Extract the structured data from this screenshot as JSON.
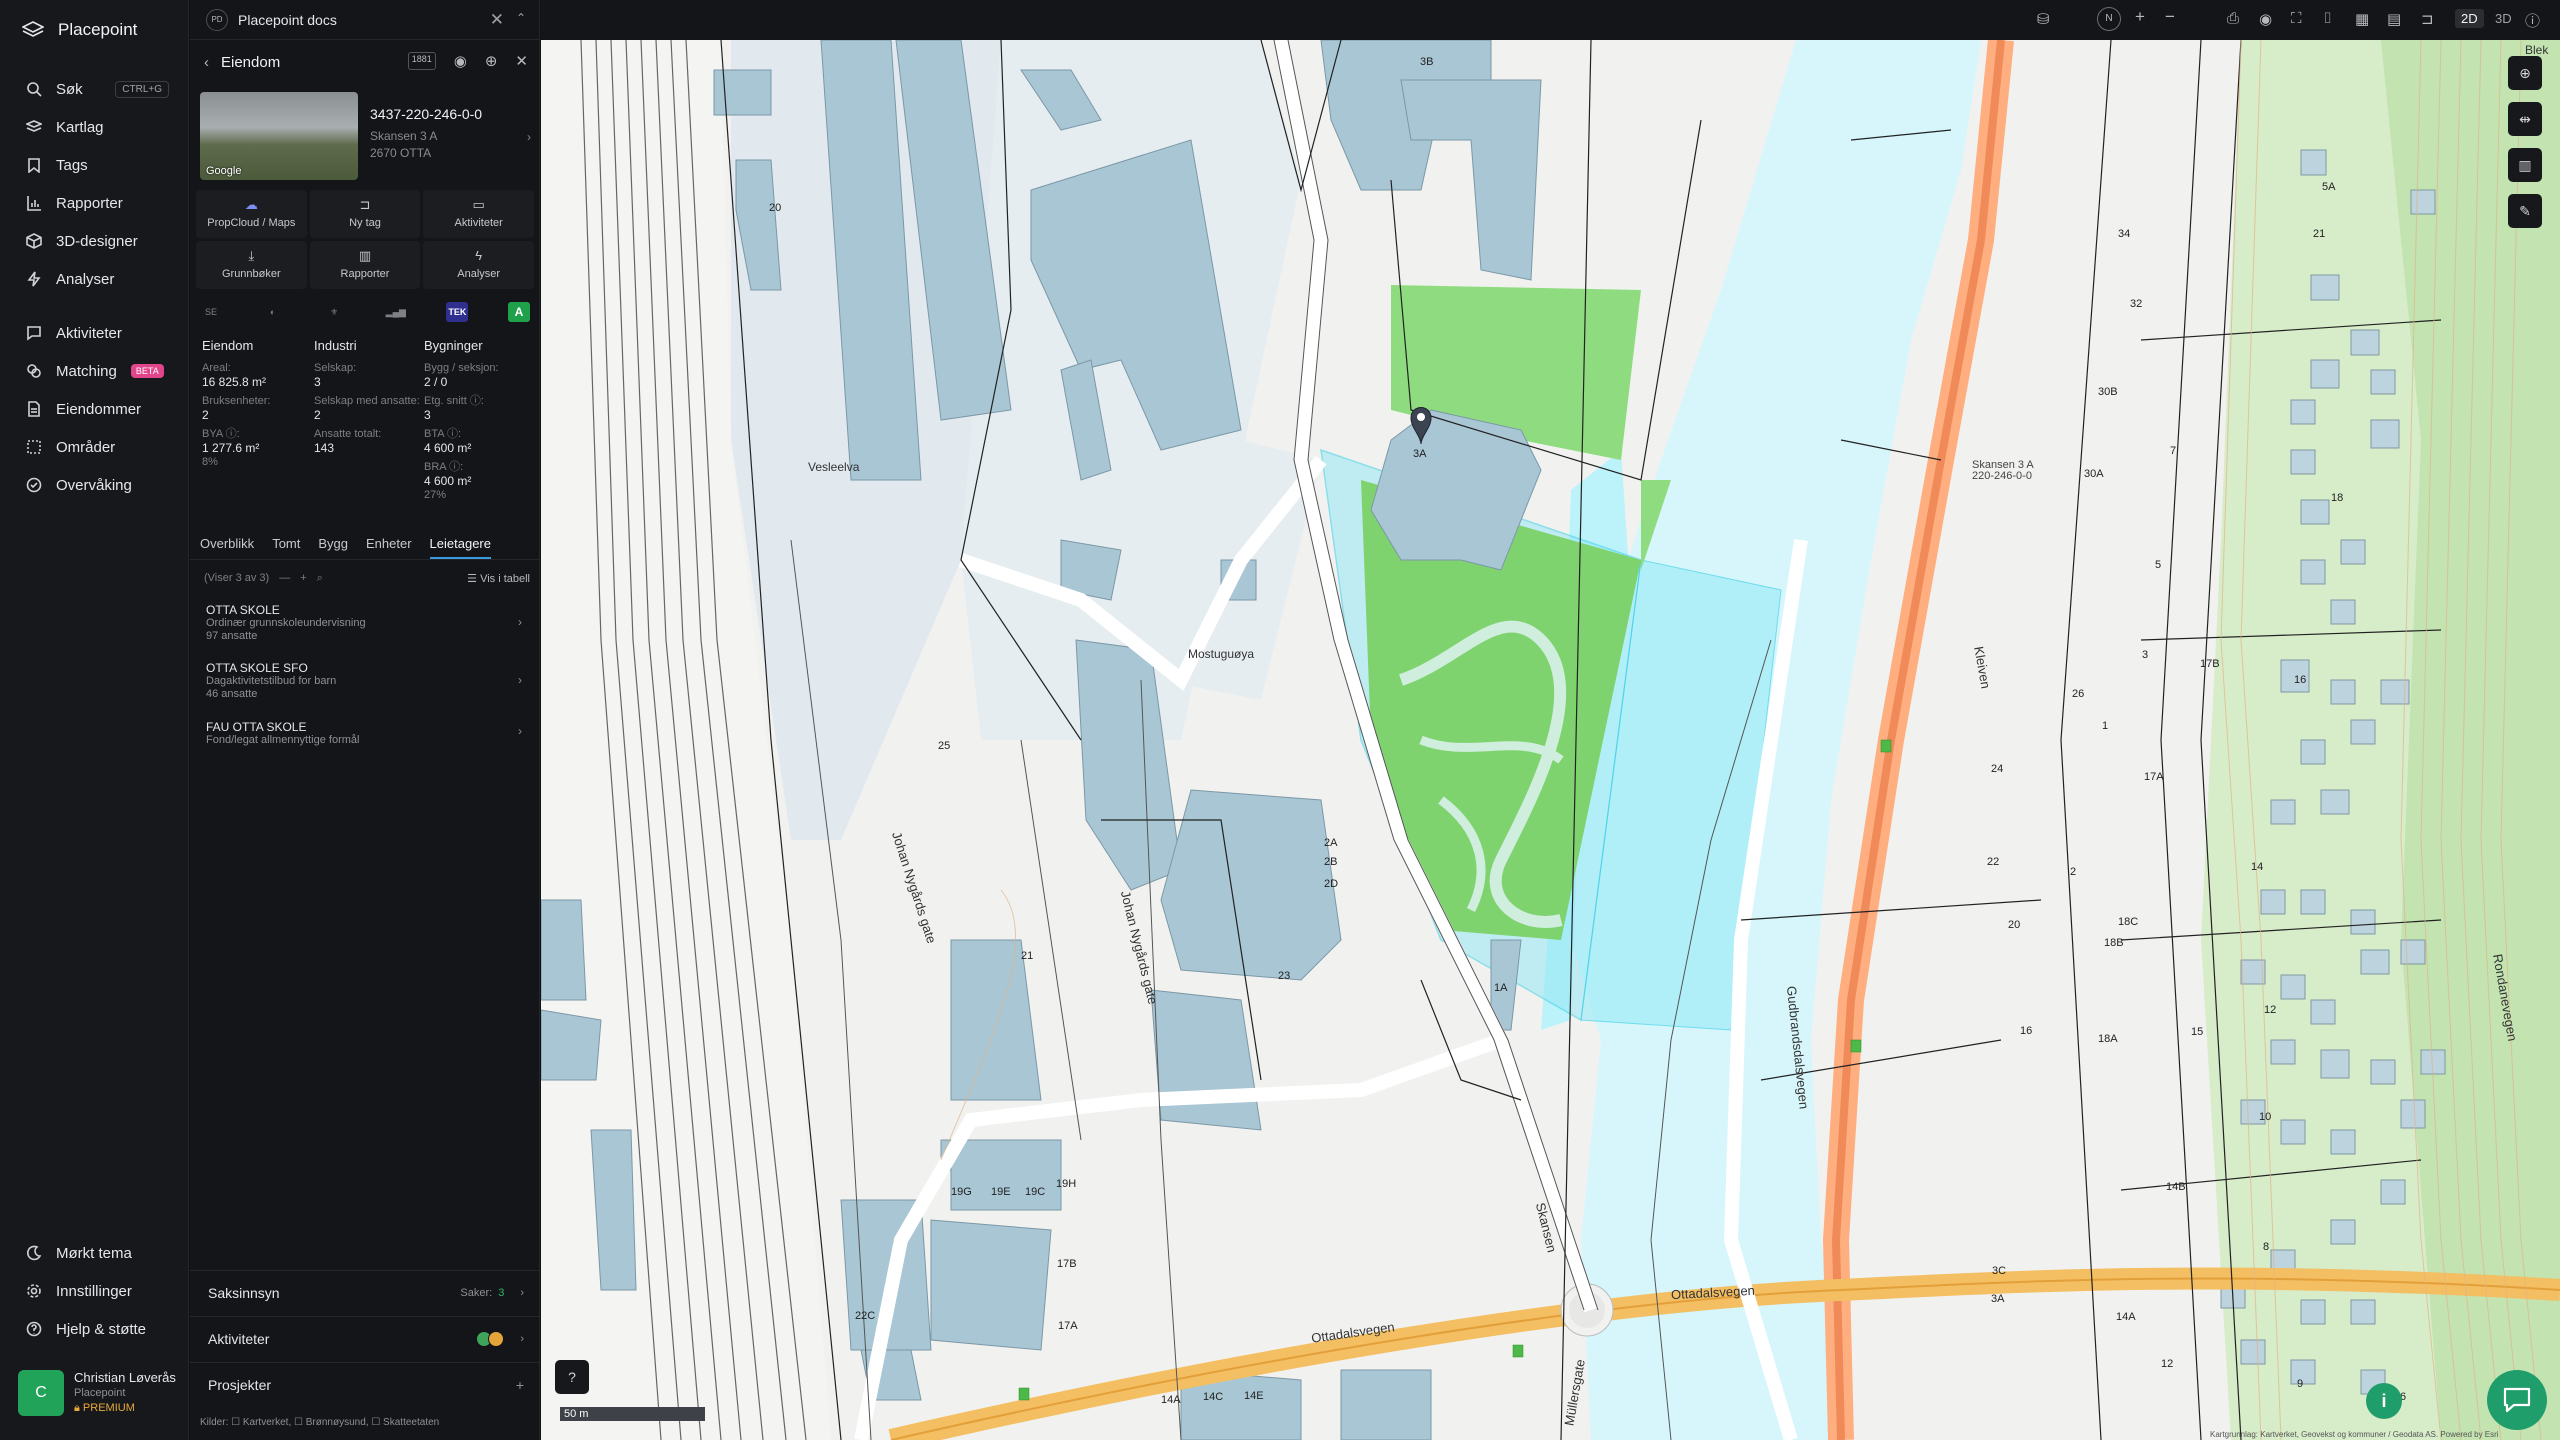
{
  "app": {
    "name": "Placepoint"
  },
  "nav": {
    "items": [
      {
        "label": "Søk",
        "shortcut": "CTRL+G",
        "icon": "search-icon"
      },
      {
        "label": "Kartlag",
        "icon": "layers-icon"
      },
      {
        "label": "Tags",
        "icon": "bookmark-icon"
      },
      {
        "label": "Rapporter",
        "icon": "bar-chart-icon"
      },
      {
        "label": "3D-designer",
        "icon": "cube-icon"
      },
      {
        "label": "Analyser",
        "icon": "bolt-icon"
      },
      {
        "label": "Aktiviteter",
        "icon": "message-icon"
      },
      {
        "label": "Matching",
        "badge": "BETA",
        "icon": "match-icon"
      },
      {
        "label": "Eiendommer",
        "icon": "document-icon"
      },
      {
        "label": "Områder",
        "icon": "area-icon"
      },
      {
        "label": "Overvåking",
        "icon": "clock-check-icon"
      }
    ],
    "bottom": [
      {
        "label": "Mørkt tema",
        "icon": "moon-icon"
      },
      {
        "label": "Innstillinger",
        "icon": "gear-icon"
      },
      {
        "label": "Hjelp & støtte",
        "icon": "help-icon"
      }
    ]
  },
  "user": {
    "initial": "C",
    "name": "Christian Løverås",
    "org": "Placepoint",
    "plan": "PREMIUM"
  },
  "panel": {
    "workspace_badge": "PD",
    "workspace": "Placepoint docs",
    "title": "Eiendom",
    "kbd": "1881",
    "photo_label": "Google",
    "property_id": "3437-220-246-0-0",
    "address": "Skansen 3 A",
    "postal": "2670 OTTA",
    "actions": [
      {
        "label": "PropCloud / Maps",
        "icon": "cloud-icon"
      },
      {
        "label": "Ny tag",
        "icon": "bookmark-icon"
      },
      {
        "label": "Aktiviteter",
        "icon": "message-icon"
      },
      {
        "label": "Grunnbøker",
        "icon": "download-icon"
      },
      {
        "label": "Rapporter",
        "icon": "bar-chart-icon"
      },
      {
        "label": "Analyser",
        "icon": "bolt-icon"
      }
    ],
    "sources": [
      "SE",
      "◐",
      "⚜",
      "▂▄▆",
      "TEK",
      "A"
    ],
    "stats": {
      "eiendom": {
        "heading": "Eiendom",
        "areal_label": "Areal:",
        "areal_value": "16 825.8 m²",
        "bruksenheter_label": "Bruksenheter:",
        "bruksenheter_value": "2",
        "bya_label": "BYA ⓘ:",
        "bya_value": "1 277.6 m²",
        "bya_pct": "8%"
      },
      "industri": {
        "heading": "Industri",
        "selskap_label": "Selskap:",
        "selskap_value": "3",
        "selskap_ansatte_label": "Selskap med ansatte:",
        "selskap_ansatte_value": "2",
        "ansatte_label": "Ansatte totalt:",
        "ansatte_value": "143"
      },
      "bygninger": {
        "heading": "Bygninger",
        "bygg_label": "Bygg / seksjon:",
        "bygg_value": "2 / 0",
        "etg_label": "Etg. snitt ⓘ:",
        "etg_value": "3",
        "bta_label": "BTA ⓘ:",
        "bta_value": "4 600 m²",
        "bra_label": "BRA ⓘ:",
        "bra_value": "4 600 m²",
        "bra_pct": "27%"
      }
    },
    "tabs": [
      "Overblikk",
      "Tomt",
      "Bygg",
      "Enheter",
      "Leietagere"
    ],
    "active_tab": "Leietagere",
    "list_count": "(Viser 3 av 3)",
    "list_table": "Vis i tabell",
    "tenants": [
      {
        "name": "OTTA SKOLE",
        "desc": "Ordinær grunnskoleundervisning",
        "employees": "97 ansatte"
      },
      {
        "name": "OTTA SKOLE SFO",
        "desc": "Dagaktivitetstilbud for barn",
        "employees": "46 ansatte"
      },
      {
        "name": "FAU OTTA SKOLE",
        "desc": "Fond/legat allmennyttige formål",
        "employees": ""
      }
    ],
    "saksinnsyn": {
      "label": "Saksinnsyn",
      "prefix": "Saker:",
      "count": "3"
    },
    "aktiviteter": {
      "label": "Aktiviteter"
    },
    "prosjekter": {
      "label": "Prosjekter"
    },
    "sources_text": "Kilder: ☐ Kartverket, ☐ Brønnøysund, ☐ Skatteetaten"
  },
  "topbar": {
    "compass": "N",
    "mode_2d": "2D",
    "mode_3d": "3D"
  },
  "map": {
    "pin_line1": "Skansen 3 A",
    "pin_line2": "220-246-0-0",
    "labels": [
      {
        "text": "Vesleelva"
      },
      {
        "text": "Mostuguøya"
      },
      {
        "text": "Johan Nygårds gate"
      },
      {
        "text": "Johan Nygårds gate"
      },
      {
        "text": "Ottadalsvegen"
      },
      {
        "text": "Ottadalsvegen"
      },
      {
        "text": "Skansen"
      },
      {
        "text": "Müllersgate"
      },
      {
        "text": "Gudbrandsdalsvegen"
      },
      {
        "text": "Kleiven"
      },
      {
        "text": "Rondanevegen"
      },
      {
        "text": "Blek"
      }
    ],
    "numbers": [
      "3B",
      "20",
      "3A",
      "25",
      "21",
      "2A",
      "2B",
      "2D",
      "23",
      "1A",
      "19G",
      "19E",
      "19C",
      "19H",
      "17B",
      "22C",
      "17A",
      "14A",
      "14C",
      "14E",
      "5A",
      "21",
      "34",
      "32",
      "30B",
      "7",
      "30A",
      "18",
      "5",
      "3",
      "17B",
      "26",
      "16",
      "1",
      "24",
      "17A",
      "22",
      "20",
      "18C",
      "18B",
      "2",
      "14",
      "16",
      "18A",
      "15",
      "12",
      "10",
      "14B",
      "8",
      "3C",
      "3A",
      "14A",
      "12",
      "9",
      "6"
    ],
    "scale": "50 m",
    "attribution": "Kartgrunnlag: Kartverket, Geovekst og kommuner / Geodata AS. Powered by Esri"
  }
}
